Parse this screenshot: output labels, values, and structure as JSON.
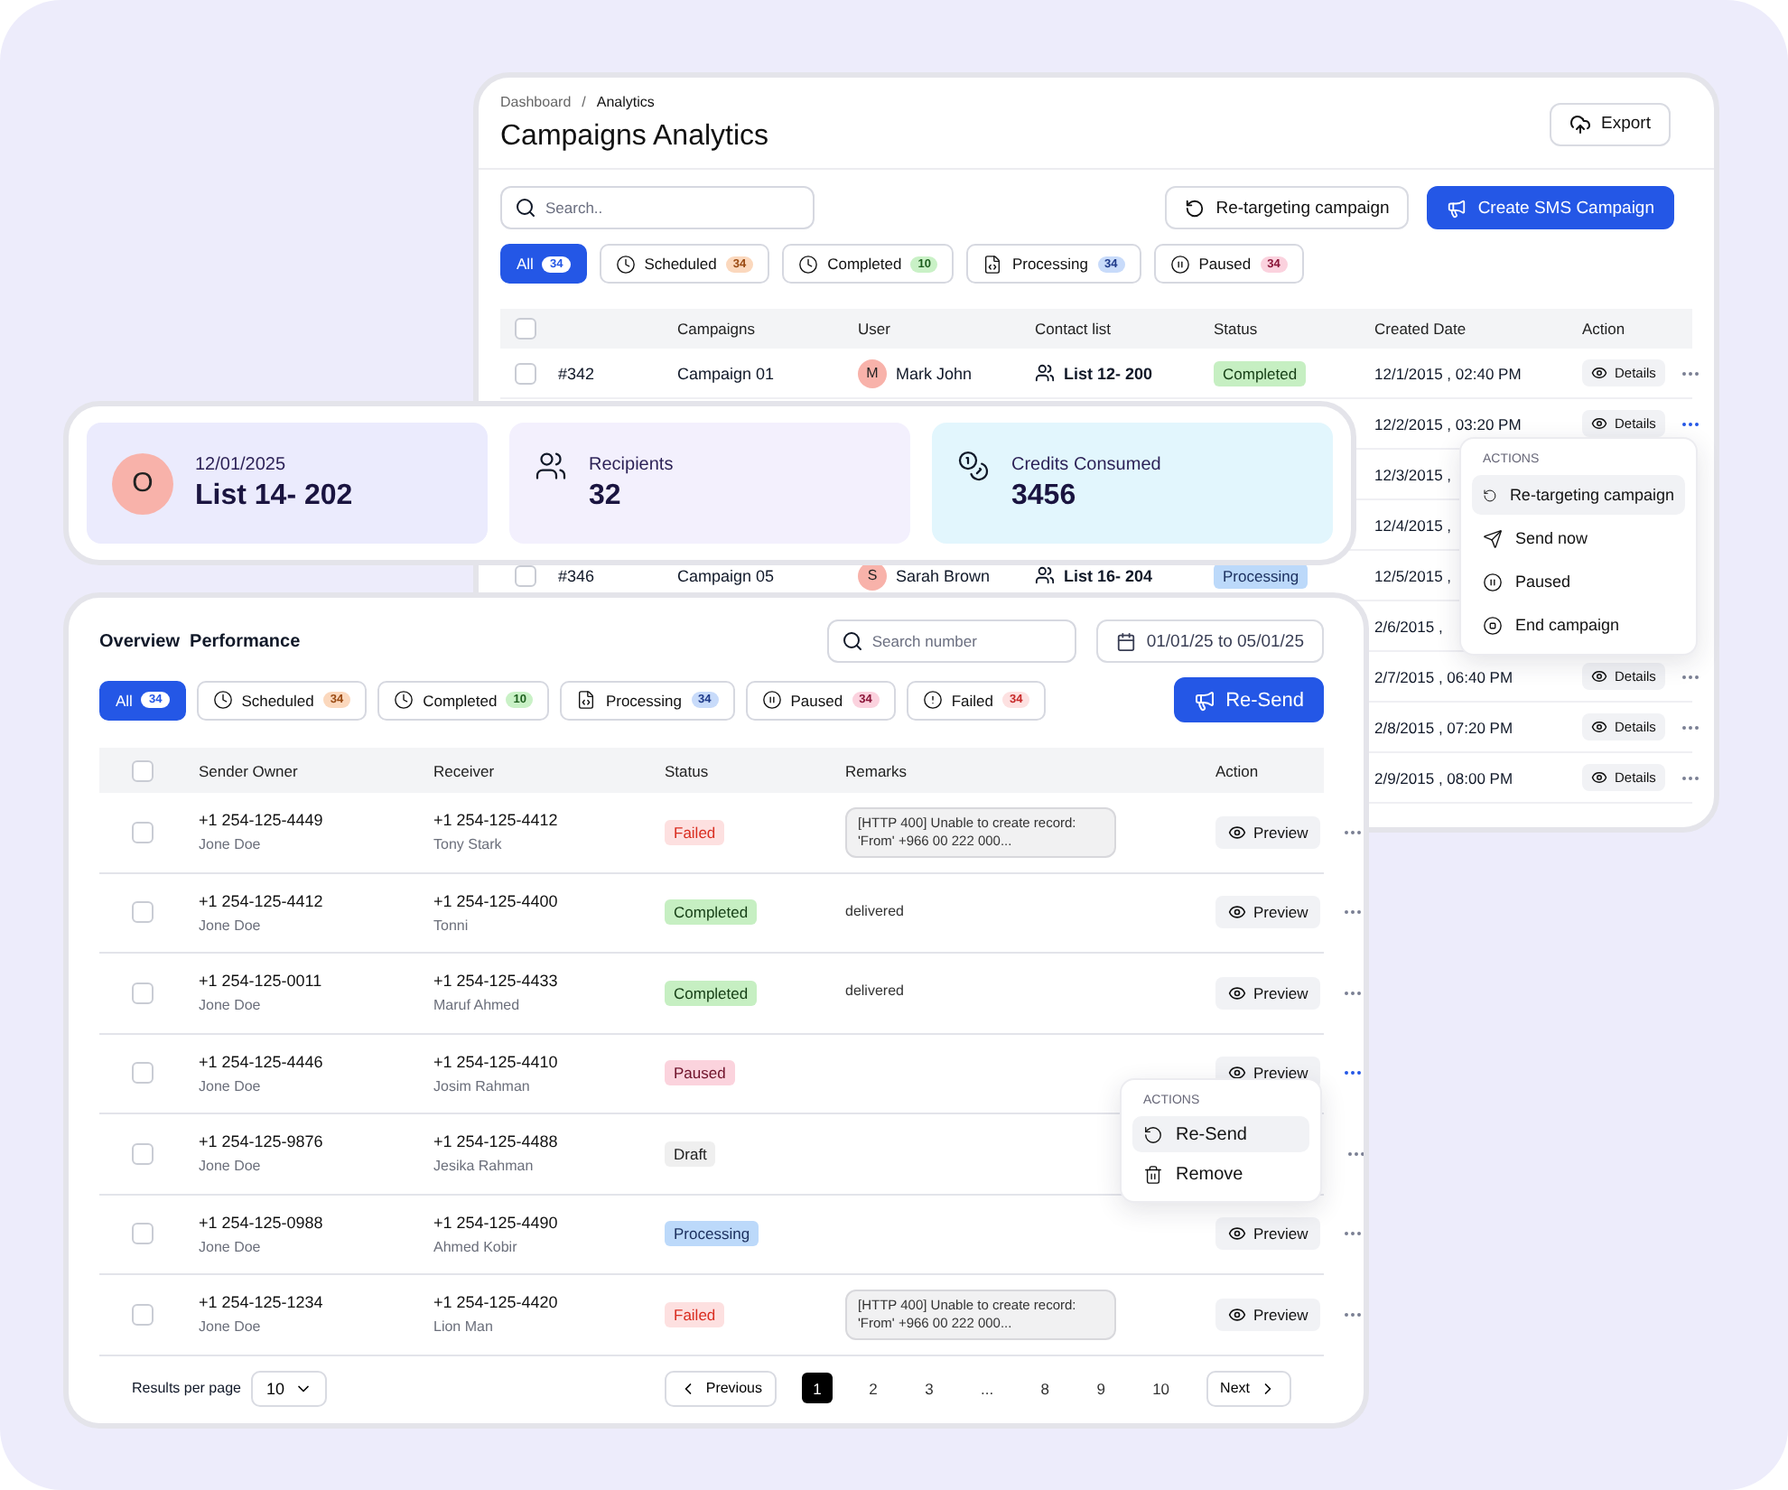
{
  "analytics": {
    "breadcrumb": [
      "Dashboard",
      "Analytics"
    ],
    "breadcrumb_separator": "/",
    "header_checked": false,
    "title": "Campaigns Analytics",
    "export_button": "Export",
    "search": {
      "placeholder": "Search.."
    },
    "retarget_button": "Re-targeting campaign",
    "create_button": "Create SMS Campaign",
    "filters": [
      {
        "kind": "all",
        "label": "All",
        "count": "34",
        "selected": true
      },
      {
        "kind": "scheduled",
        "label": "Scheduled",
        "count": "34",
        "selected": false
      },
      {
        "kind": "completed",
        "label": "Completed",
        "count": "10",
        "selected": false
      },
      {
        "kind": "processing",
        "label": "Processing",
        "count": "34",
        "selected": false
      },
      {
        "kind": "paused",
        "label": "Paused",
        "count": "34",
        "selected": false
      }
    ],
    "columns": [
      "Campaigns",
      "User",
      "Contact list",
      "Status",
      "Created Date",
      "Action"
    ],
    "rows": [
      {
        "checked": false,
        "id": "#342",
        "campaign": "Campaign 01",
        "user": {
          "initial": "M",
          "name": "Mark John"
        },
        "contact": "List 12- 200",
        "status": {
          "kind": "completed",
          "label": "Completed"
        },
        "created": "12/1/2015 , 02:40 PM",
        "action": "Details",
        "menu_open": false
      },
      {
        "created": "12/2/2015 , 03:20 PM",
        "action": "Details",
        "menu_open": true
      },
      {
        "created": "12/3/2015 ,"
      },
      {
        "created": "12/4/2015 ,"
      },
      {
        "checked": false,
        "id": "#346",
        "campaign": "Campaign 05",
        "user": {
          "initial": "S",
          "name": "Sarah Brown"
        },
        "contact": "List 16- 204",
        "status": {
          "kind": "processing",
          "label": "Processing"
        },
        "created": "12/5/2015 ,"
      },
      {
        "created": "2/6/2015 ,"
      },
      {
        "created": "2/7/2015 , 06:40 PM",
        "action": "Details",
        "menu_open": false
      },
      {
        "created": "2/8/2015 , 07:20 PM",
        "action": "Details",
        "menu_open": false
      },
      {
        "created": "2/9/2015 , 08:00 PM",
        "action": "Details",
        "menu_open": false
      }
    ],
    "menu": {
      "heading": "ACTIONS",
      "items": [
        {
          "kind": "retarget",
          "label": "Re-targeting campaign",
          "selected": true
        },
        {
          "kind": "send",
          "label": "Send now",
          "selected": false
        },
        {
          "kind": "pause",
          "label": "Paused",
          "selected": false
        },
        {
          "kind": "end",
          "label": "End campaign",
          "selected": false
        }
      ]
    }
  },
  "summary": {
    "avatar": "O",
    "date": "12/01/2025",
    "list": "List 14- 202",
    "recipients_label": "Recipients",
    "recipients": "32",
    "credits_label": "Credits Consumed",
    "credits": "3456"
  },
  "overview": {
    "title": "Overview  Performance",
    "header_checked": false,
    "search": {
      "placeholder": "Search number"
    },
    "date_range": "01/01/25 to 05/01/25",
    "resend_button": "Re-Send",
    "filters": [
      {
        "kind": "all",
        "label": "All",
        "count": "34",
        "selected": true
      },
      {
        "kind": "scheduled",
        "label": "Scheduled",
        "count": "34",
        "selected": false
      },
      {
        "kind": "completed",
        "label": "Completed",
        "count": "10",
        "selected": false
      },
      {
        "kind": "processing",
        "label": "Processing",
        "count": "34",
        "selected": false
      },
      {
        "kind": "paused",
        "label": "Paused",
        "count": "34",
        "selected": false
      },
      {
        "kind": "failed",
        "label": "Failed",
        "count": "34",
        "selected": false
      }
    ],
    "columns": [
      "Sender Owner",
      "Receiver",
      "Status",
      "Remarks",
      "Action"
    ],
    "rows": [
      {
        "checked": false,
        "sender": "+1 254-125-4449",
        "sender_name": "Jone Doe",
        "receiver": "+1 254-125-4412",
        "receiver_name": "Tony Stark",
        "status": {
          "kind": "failed",
          "label": "Failed"
        },
        "remarks": "[HTTP 400] Unable to create record: 'From' +966 00  222 000...",
        "action": "Preview",
        "menu_open": false
      },
      {
        "checked": false,
        "sender": "+1 254-125-4412",
        "sender_name": "Jone Doe",
        "receiver": "+1 254-125-4400",
        "receiver_name": "Tonni",
        "status": {
          "kind": "completed",
          "label": "Completed"
        },
        "remarks": "delivered",
        "action": "Preview",
        "menu_open": false
      },
      {
        "checked": false,
        "sender": "+1 254-125-0011",
        "sender_name": "Jone Doe",
        "receiver": "+1 254-125-4433",
        "receiver_name": "Maruf Ahmed",
        "status": {
          "kind": "completed",
          "label": "Completed"
        },
        "remarks": "delivered",
        "action": "Preview",
        "menu_open": false
      },
      {
        "checked": false,
        "sender": "+1 254-125-4446",
        "sender_name": "Jone Doe",
        "receiver": "+1 254-125-4410",
        "receiver_name": "Josim Rahman",
        "status": {
          "kind": "paused",
          "label": "Paused"
        },
        "action": "Preview",
        "menu_open": true
      },
      {
        "checked": false,
        "sender": "+1 254-125-9876",
        "sender_name": "Jone Doe",
        "receiver": "+1 254-125-4488",
        "receiver_name": "Jesika Rahman",
        "status": {
          "kind": "draft",
          "label": "Draft"
        },
        "menu_open": false
      },
      {
        "checked": false,
        "sender": "+1 254-125-0988",
        "sender_name": "Jone Doe",
        "receiver": "+1 254-125-4490",
        "receiver_name": "Ahmed Kobir",
        "status": {
          "kind": "processing",
          "label": "Processing"
        },
        "action": "Preview",
        "menu_open": false
      },
      {
        "checked": false,
        "sender": "+1 254-125-1234",
        "sender_name": "Jone Doe",
        "receiver": "+1 254-125-4420",
        "receiver_name": "Lion Man",
        "status": {
          "kind": "failed",
          "label": "Failed"
        },
        "remarks": "[HTTP 400] Unable to create record: 'From' +966 00  222 000...",
        "action": "Preview",
        "menu_open": false
      }
    ],
    "menu": {
      "heading": "ACTIONS",
      "items": [
        {
          "kind": "resend",
          "label": "Re-Send",
          "selected": true
        },
        {
          "kind": "remove",
          "label": "Remove",
          "selected": false
        }
      ]
    },
    "pagination": {
      "label": "Results per page",
      "per_page": "10",
      "previous": "Previous",
      "pages": [
        {
          "label": "1",
          "selected": true
        },
        {
          "label": "2",
          "selected": false
        },
        {
          "label": "3",
          "selected": false
        },
        {
          "label": "...",
          "selected": false
        },
        {
          "label": "8",
          "selected": false
        },
        {
          "label": "9",
          "selected": false
        },
        {
          "label": "10",
          "selected": false
        }
      ],
      "next": "Next"
    }
  }
}
